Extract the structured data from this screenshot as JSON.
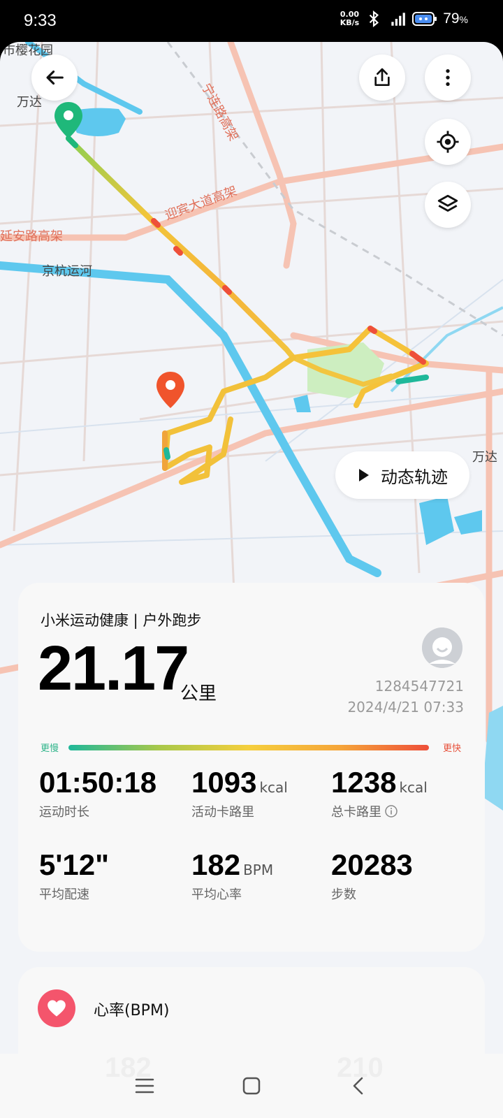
{
  "status_bar": {
    "time": "9:33",
    "net_speed_value": "0.00",
    "net_speed_unit": "KB/s",
    "battery": "79",
    "battery_unit": "%"
  },
  "map": {
    "labels": {
      "top_left": "市樱花园",
      "wanda_left": "万达",
      "ningben": "宁连路高架",
      "yingbin": "迎宾大道高架",
      "xianan": "延安路高架",
      "jinghang": "京杭运河",
      "wanda_right": "万达"
    },
    "dynamic_track_label": "动态轨迹"
  },
  "summary": {
    "source": "小米运动健康 | 户外跑步",
    "distance": "21.17",
    "distance_unit": "公里",
    "user_id": "1284547721",
    "datetime": "2024/4/21 07:33",
    "slower": "更慢",
    "faster": "更快",
    "metrics": {
      "duration": {
        "value": "01:50:18",
        "unit": "",
        "label": "运动时长"
      },
      "active_cal": {
        "value": "1093",
        "unit": "kcal",
        "label": "活动卡路里"
      },
      "total_cal": {
        "value": "1238",
        "unit": "kcal",
        "label": "总卡路里"
      },
      "pace": {
        "value": "5'12\"",
        "unit": "",
        "label": "平均配速"
      },
      "heart_rate": {
        "value": "182",
        "unit": "BPM",
        "label": "平均心率"
      },
      "steps": {
        "value": "20283",
        "unit": "",
        "label": "步数"
      }
    }
  },
  "heart_card": {
    "title": "心率(BPM)",
    "value_left": "182",
    "value_right": "210"
  },
  "icons": {
    "back": "arrow-left-icon",
    "share": "share-icon",
    "more": "more-vertical-icon",
    "locate": "locate-icon",
    "layers": "layers-icon",
    "play": "play-icon",
    "heart": "heart-icon"
  },
  "colors": {
    "route_start": "#1fb87a",
    "route_end": "#f0542c",
    "heart": "#f4556c",
    "water": "#5ec8ee"
  }
}
